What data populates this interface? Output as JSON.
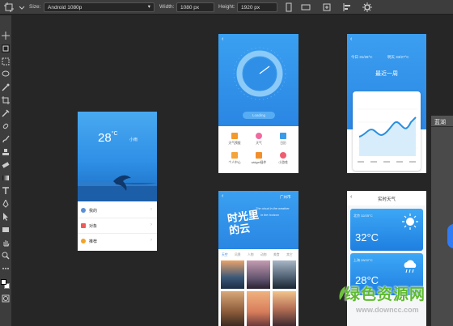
{
  "optionsbar": {
    "size_label": "Size:",
    "size_value": "Android 1080p",
    "width_label": "Width:",
    "width_value": "1080 px",
    "height_label": "Height:",
    "height_value": "1920 px"
  },
  "panel": {
    "tab_label": "蓝湖"
  },
  "mockups": {
    "home": {
      "temp": "28",
      "unit": "°C",
      "condition": "小雨",
      "menu": [
        "我的",
        "对象",
        "推荐"
      ]
    },
    "dial": {
      "button": "Loading",
      "grid": [
        "天气预报",
        "天气",
        "日历",
        "个人中心",
        "widget插件",
        "小游戏"
      ]
    },
    "week": {
      "today": "今日 31/26°C",
      "tomorrow": "明天 33/27°C",
      "title": "最近一周"
    },
    "gallery": {
      "city": "广州市",
      "poem_line1": "The cloud in the weather",
      "poem_line2": "in the horizon",
      "title_art": "时光里的云",
      "tabs": [
        "天空",
        "风景",
        "人物",
        "动物",
        "美食",
        "其它"
      ]
    },
    "realtime": {
      "title": "实时天气",
      "card1_city": "北京 32/25°C",
      "card1_temp": "32°C",
      "card2_city": "上海 28/22°C",
      "card2_temp": "28°C"
    }
  },
  "watermark": {
    "text": "绿色资源网",
    "url": "www.downcc.com"
  }
}
